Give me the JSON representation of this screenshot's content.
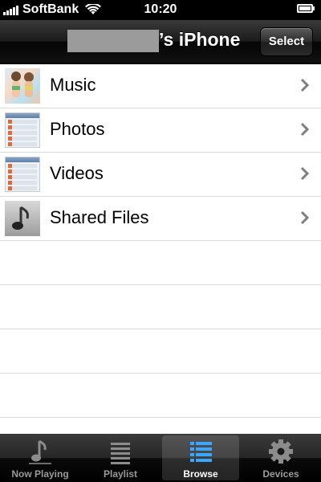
{
  "status_bar": {
    "carrier": "SoftBank",
    "time": "10:20"
  },
  "nav": {
    "title": "’s iPhone",
    "select_label": "Select"
  },
  "rows": [
    {
      "label": "Music",
      "thumb": "photo-thumbnail"
    },
    {
      "label": "Photos",
      "thumb": "screenshot-thumbnail"
    },
    {
      "label": "Videos",
      "thumb": "screenshot-thumbnail"
    },
    {
      "label": "Shared Files",
      "thumb": "music-note-icon"
    }
  ],
  "tabs": [
    {
      "label": "Now Playing",
      "icon": "music-note-icon",
      "active": false
    },
    {
      "label": "Playlist",
      "icon": "list-icon",
      "active": false
    },
    {
      "label": "Browse",
      "icon": "browse-list-icon",
      "active": true
    },
    {
      "label": "Devices",
      "icon": "gear-icon",
      "active": false
    }
  ],
  "colors": {
    "active_tab_icon": "#39a6ff",
    "inactive_tab": "#9a9a9a",
    "row_divider": "#d9d9d9",
    "redaction": "#9b9b9b"
  }
}
